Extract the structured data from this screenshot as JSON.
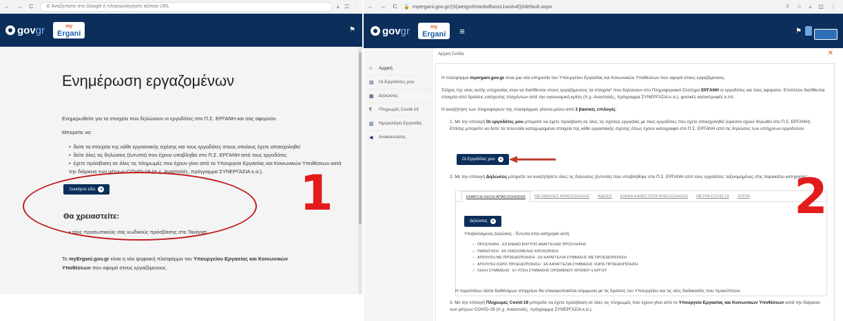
{
  "left": {
    "browser": {
      "nav_icons": "← → C",
      "url_placeholder": "G Αναζητήστε στο Google ή πληκτρολογήστε κάποιο URL",
      "right_icons": "⤓ ◫ ⋮"
    },
    "header": {
      "gov_brand": "gov",
      "gov_suffix": "gr",
      "ergani_top": "my",
      "ergani_bottom": "Ergani",
      "flag_icon": "⚑"
    },
    "title": "Ενημέρωση εργαζομένων",
    "description": "Ενημερωθείτε για τα στοιχεία που δηλώνουν οι εργοδότες στο Π.Σ. ΕΡΓΑΝΗ και σας αφορούν.",
    "can_label": "Μπορείτε να:",
    "bullets": [
      "δείτε τα στοιχεία της κάθε εργασιακής σχέσης και τους εργοδότες στους οποίους έχετε απασχοληθεί",
      "δείτε όλες τις δηλώσεις (έντυπα) που έχουν υποβληθεί στο Π.Σ. ΕΡΓΑΝΗ από τους εργοδότες",
      "έχετε πρόσβαση σε όλες τις πληρωμές που έχουν γίνει από το Υπουργείο Εργασίας και Κοινωνικών Υποθέσεων κατά την διάρκεια των μέτρων COVID-19 (π.χ. Αναστολές, πρόγραμμα ΣΥΝΕΡΓΑΣΙΑ κ.α.)."
    ],
    "start_button": "Ξεκινήστε εδώ",
    "need_title": "Θα χρειαστείτε:",
    "need_item": "τους προσωπικούς σας κωδικούς πρόσβασης στο Taxisnet",
    "footer_pre": "Το ",
    "footer_site": "myErgani.gov.gr",
    "footer_mid": " είναι η νέα ψηφιακή πλατφόρμα του ",
    "footer_ministry": "Υπουργείου Εργασίας και Κοινωνικών Υποθέσεων",
    "footer_post": " που αφορά στους εργαζόμενους.",
    "annotation_number": "1"
  },
  "right": {
    "browser": {
      "nav_icons": "← → C",
      "url": "myergani.gov.gr/(S(weqyo5rtaobdfuoss1wslv4l))/default.aspx",
      "right_icons": "⇪ ☆ ⤓ ◫ ⋮"
    },
    "header": {
      "gov_brand": "gov",
      "gov_suffix": "gr",
      "ergani_top": "my",
      "ergani_bottom": "Ergani",
      "menu_icon": "≡",
      "flag_icon": "⚑"
    },
    "sidebar": [
      {
        "icon": "⌂",
        "label": "Αρχική"
      },
      {
        "icon": "▤",
        "label": "Οι Εργοδότες μου"
      },
      {
        "icon": "▦",
        "label": "Δηλώσεις"
      },
      {
        "icon": "€",
        "label": "Πληρωμές Covid-19"
      },
      {
        "icon": "▥",
        "label": "Ημερολόγιο Εργασίας"
      },
      {
        "icon": "◀",
        "label": "Ανακοινώσεις"
      }
    ],
    "breadcrumb": "Αρχική Σελίδα",
    "close_icon": "✕",
    "intro_pre": "Η πλατφόρμα ",
    "intro_bold": "myergani.gov.gr",
    "intro_post": " είναι μια νέα υπηρεσία του Υπουργείου Εργασίας και Κοινωνικών Υποθέσεων που αφορά στους εργαζόμενους.",
    "purpose_pre": "Στόχος της νέας αυτής υπηρεσίας είναι να διατίθενται στους εργαζόμενους τα στοιχεία* που δηλώνουν στο Πληροφοριακό Σύστημα ",
    "purpose_bold": "ΕΡΓΑΝΗ",
    "purpose_post": " οι εργοδότες και τους αφορούν. Επιπλέον διατίθενται στοιχεία από δράσεις ενίσχυσης πληγέντων από την υγειονομική κρίση (π.χ. Αναστολές, πρόγραμμα ΣΥΝΕΡΓΑΣΙΑ κ.α.), φυσικές καταστροφές κ.λπ.",
    "search_pre": "Η αναζήτηση των πληροφοριών της πλατφόρμας γίνεται μέσω από ",
    "search_bold": "3 βασικές επιλογές",
    "search_post": ":",
    "option1_pre": "1. Με την επιλογή ",
    "option1_bold": "Οι εργοδότες μου",
    "option1_post": " μπορείτε να έχετε πρόσβαση σε όλες τις σχέσεις εργασίας με τους εργοδότες που έχετε απασχοληθεί (εφόσον έχουν δηλωθεί στο Π.Σ. ΕΡΓΑΝΗ). Επίσης μπορείτε να δείτε τα τελευταία καταχωρημένα στοιχεία της κάθε εργασιακής σχέσης όπως έχουν καταγραφεί στο Π.Σ. ΕΡΓΑΝΗ από τις δηλώσεις των υπόχρεων εργοδοτών.",
    "employers_button": "Οι Εργοδότες μου",
    "option2_pre": "2. Με την επιλογή ",
    "option2_bold": "Δηλώσεις",
    "option2_post": " μπορείτε να αναζητήσετε όλες τις δηλώσεις (έντυπα) που υποβλήθηκε στο Π.Σ. ΕΡΓΑΝΗ από τους εργοδότες ταξινομημένες στις παρακάτω κατηγορίες:",
    "tabs": [
      "ΕΝΑΡΞΗ-ΛΗΞΗ ΑΠΑΣΧΟΛΗΣΗΣ",
      "ΜΕΤΑΒΟΛΕΣ ΑΠΑΣΧΟΛΗΣΗΣ",
      "ΑΔΕΙΕΣ",
      "ΕΙΔΙΚΑ ΚΑΘΕΣΤΩΤΑ ΑΠΑΣΧΟΛΗΣΗΣ",
      "ΜΕΤΡΑ COVID-19",
      "ΛΟΙΠΑ"
    ],
    "declarations_button": "Δηλώσεις",
    "submitted_label": "Υποβαλλόμενες Δηλώσεις - Έντυπα στην κατηγορία αυτή:",
    "forms": [
      "ΠΡΟΣΛΗΨΗ : Ε3 ΕΝΙΑΙΟ ΕΝΤΥΠΟ ΑΝΑΓΓΕΛΙΑΣ ΠΡΟΣΛΗΨΗΣ",
      "ΠΑΡΑΙΤΗΣΗ : Ε5 ΟΙΚΕΙΟΘΕΛΗΣ ΑΠΟΧΩΡΗΣΗ",
      "ΑΠΟΛΥΣΗ ΜΕ ΠΡΟΕΙΔΟΠΟΙΗΣΗ : Ε6 ΚΑΤΑΓΓΕΛΙΑ ΣΥΜΒΑΣΗΣ ΜΕ ΠΡΟΕΙΔΟΠΟΙΗΣΗ",
      "ΑΠΟΛΥΣΗ ΧΩΡΙΣ ΠΡΟΕΙΔΟΠΟΙΗΣΗ : Ε6 ΚΑΤΑΓΓΕΛΙΑ ΣΥΜΒΑΣΗΣ ΧΩΡΙΣ ΠΡΟΕΙΔΟΠΟΙΗΣΗ",
      "ΛΗΞΗ ΣΥΜΒΑΣΗΣ : Ε7 ΛΥΣΗ ΣΥΜΒΑΣΗΣ ΟΡΙΣΜΕΝΟΥ ΧΡΟΝΟΥ ή ΕΡΓΟΥ"
    ],
    "list_note": "Η παραπάνω λίστα διαθέσιμων στοιχείων θα επικαιροποιείται σύμφωνα με τις δράσεις του Υπουργείου και τις νέες διαδικασίες που προκύπτουν.",
    "option3_pre": "3. Με την επιλογή ",
    "option3_bold": "Πληρωμές Covid-19",
    "option3_mid": " μπορείτε να έχετε πρόσβαση σε όλες τις πληρωμές που έχουν γίνει από το ",
    "option3_bold2": "Υπουργείο Εργασίας και Κοινωνικών Υποθέσεων",
    "option3_post": " κατά την διάρκεια των μέτρων COVID-19 (π.χ. Αναστολές, πρόγραμμα ΣΥΝΕΡΓΑΣΙΑ κ.α.).",
    "annotation_number": "2"
  },
  "colors": {
    "header_bg": "#0b2e5b",
    "annotation_red": "#e31b1b",
    "arrow_red": "#c0392b"
  }
}
